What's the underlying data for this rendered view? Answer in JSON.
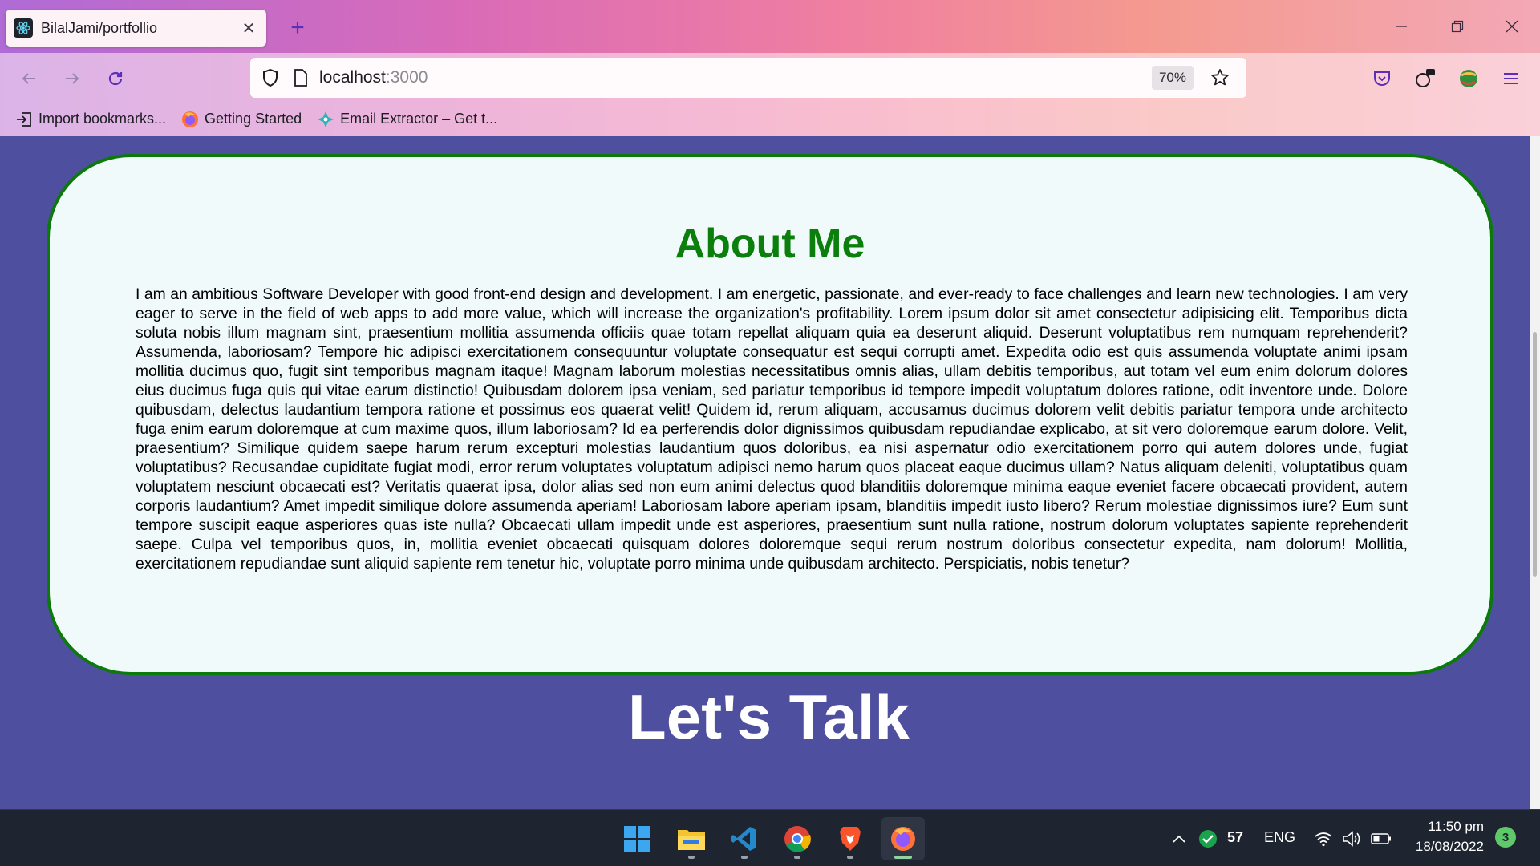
{
  "browser": {
    "tab_title": "BilalJami/portfollio",
    "tab_close": "✕",
    "new_tab": "+",
    "url_host": "localhost",
    "url_port": ":3000",
    "zoom": "70%",
    "window_controls": {
      "minimize": "—",
      "restore": "❐",
      "close": "✕"
    }
  },
  "bookmarks": [
    {
      "label": "Import bookmarks...",
      "icon": "import-icon"
    },
    {
      "label": "Getting Started",
      "icon": "firefox-icon"
    },
    {
      "label": "Email Extractor – Get t...",
      "icon": "extractor-icon"
    }
  ],
  "page": {
    "about_title": "About Me",
    "about_text": "I am an ambitious Software Developer with good front-end design and development. I am energetic, passionate, and ever-ready to face challenges and learn new technologies. I am very eager to serve in the field of web apps to add more value, which will increase the organization's profitability. Lorem ipsum dolor sit amet consectetur adipisicing elit. Temporibus dicta soluta nobis illum magnam sint, praesentium mollitia assumenda officiis quae totam repellat aliquam quia ea deserunt aliquid. Deserunt voluptatibus rem numquam reprehenderit? Assumenda, laboriosam? Tempore hic adipisci exercitationem consequuntur voluptate consequatur est sequi corrupti amet. Expedita odio est quis assumenda voluptate animi ipsam mollitia ducimus quo, fugit sint temporibus magnam itaque! Magnam laborum molestias necessitatibus omnis alias, ullam debitis temporibus, aut totam vel eum enim dolorum dolores eius ducimus fuga quis qui vitae earum distinctio! Quibusdam dolorem ipsa veniam, sed pariatur temporibus id tempore impedit voluptatum dolores ratione, odit inventore unde. Dolore quibusdam, delectus laudantium tempora ratione et possimus eos quaerat velit! Quidem id, rerum aliquam, accusamus ducimus dolorem velit debitis pariatur tempora unde architecto fuga enim earum doloremque at cum maxime quos, illum laboriosam? Id ea perferendis dolor dignissimos quibusdam repudiandae explicabo, at sit vero doloremque earum dolore. Velit, praesentium? Similique quidem saepe harum rerum excepturi molestias laudantium quos doloribus, ea nisi aspernatur odio exercitationem porro qui autem dolores unde, fugiat voluptatibus? Recusandae cupiditate fugiat modi, error rerum voluptates voluptatum adipisci nemo harum quos placeat eaque ducimus ullam? Natus aliquam deleniti, voluptatibus quam voluptatem nesciunt obcaecati est? Veritatis quaerat ipsa, dolor alias sed non eum animi delectus quod blanditiis doloremque minima eaque eveniet facere obcaecati provident, autem corporis laudantium? Amet impedit similique dolore assumenda aperiam! Laboriosam labore aperiam ipsam, blanditiis impedit iusto libero? Rerum molestiae dignissimos iure? Eum sunt tempore suscipit eaque asperiores quas iste nulla? Obcaecati ullam impedit unde est asperiores, praesentium sunt nulla ratione, nostrum dolorum voluptates sapiente reprehenderit saepe. Culpa vel temporibus quos, in, mollitia eveniet obcaecati quisquam dolores doloremque sequi rerum nostrum doloribus consectetur expedita, nam dolorum! Mollitia, exercitationem repudiandae sunt aliquid sapiente rem tenetur hic, voluptate porro minima unde quibusdam architecto. Perspiciatis, nobis tenetur?",
    "talk_title": "Let's Talk"
  },
  "colors": {
    "page_bg": "#4e509f",
    "card_bg": "#f0fafa",
    "card_border": "#0b7a0b",
    "title_green": "#0b7f0b"
  },
  "taskbar": {
    "apps": [
      "windows-start-icon",
      "file-explorer-icon",
      "vscode-icon",
      "chrome-icon",
      "brave-icon",
      "firefox-icon"
    ],
    "tray": {
      "chevron": "^",
      "temperature": "57",
      "language": "ENG",
      "time": "11:50 pm",
      "date": "18/08/2022",
      "notifications": "3"
    }
  }
}
